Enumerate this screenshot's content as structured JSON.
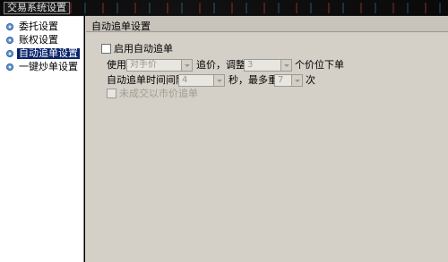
{
  "window": {
    "title": "交易系统设置"
  },
  "tree": {
    "items": [
      {
        "label": "委托设置",
        "icon": "gear-icon",
        "selected": false
      },
      {
        "label": "账权设置",
        "icon": "gear-icon",
        "selected": false
      },
      {
        "label": "自动追单设置",
        "icon": "gear-icon",
        "selected": true
      },
      {
        "label": "一键炒单设置",
        "icon": "gear-icon",
        "selected": false
      }
    ]
  },
  "panel": {
    "header": "自动追单设置",
    "enable_label": "启用自动追单",
    "use_label": "使用",
    "price_type_value": "对手价",
    "chase_label": "追价，调整",
    "adjust_value": "3",
    "adjust_suffix": "个价位下单",
    "interval_label": "自动追单时间间隔",
    "interval_value": "4",
    "interval_suffix": "秒，最多重复",
    "repeat_value": "7",
    "repeat_suffix": "次",
    "market_label": "未成交以市价追单"
  },
  "colors": {
    "selected_bg": "#0a246a",
    "panel_bg": "#d4d0c8"
  }
}
